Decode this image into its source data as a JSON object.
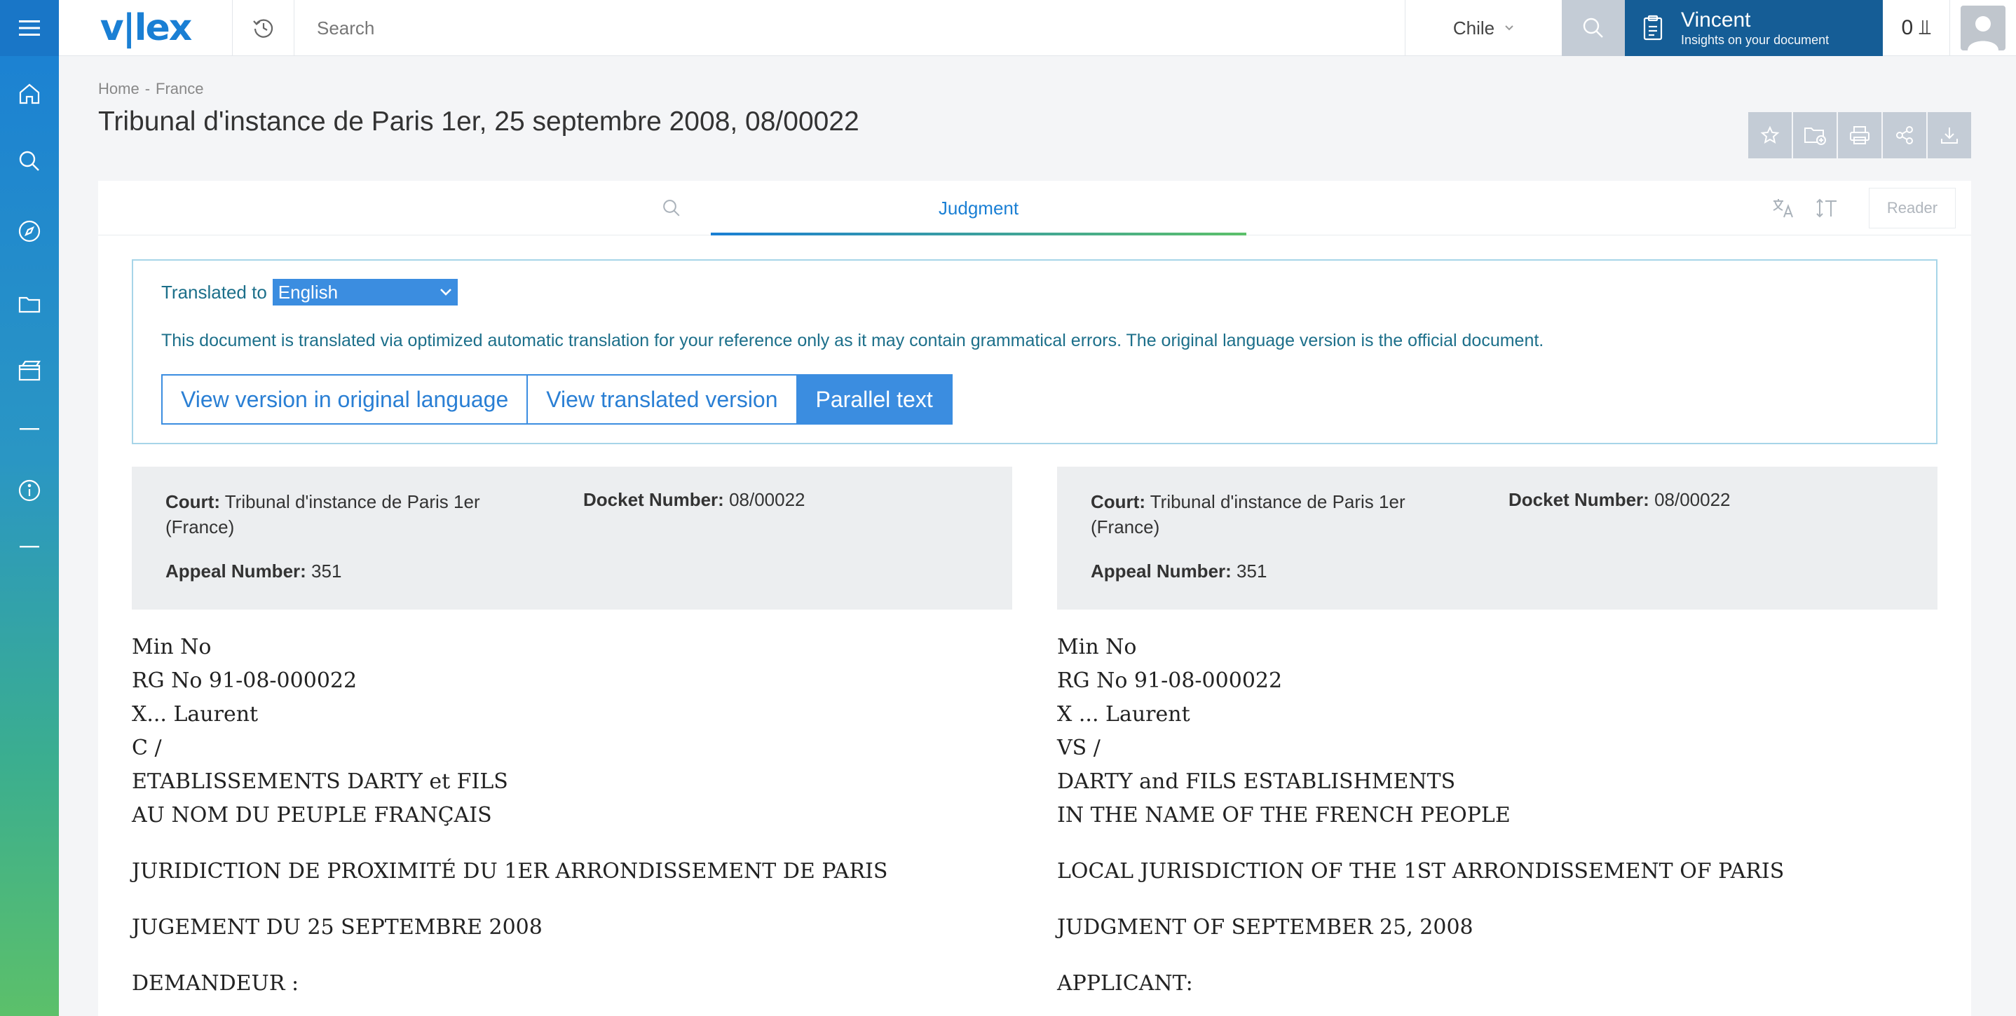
{
  "header": {
    "logo": "v|lex",
    "search_placeholder": "Search",
    "country": "Chile",
    "insights": {
      "title": "Vincent",
      "subtitle": "Insights on your document"
    },
    "credits": "0 ⫫"
  },
  "sidebar": {
    "items": [
      "menu-icon",
      "home-icon",
      "search-icon",
      "compass-icon",
      "folder-icon",
      "video-icon",
      "dash-icon",
      "info-icon",
      "dash-icon"
    ]
  },
  "breadcrumb": [
    "Home",
    "-",
    "France"
  ],
  "page_title": "Tribunal d'instance de Paris 1er, 25 septembre 2008, 08/00022",
  "document": {
    "tab_label": "Judgment",
    "reader_label": "Reader",
    "translation": {
      "label": "Translated to",
      "language": "English",
      "note": "This document is translated via optimized automatic translation for your reference only as it may contain grammatical errors. The original language version is the official document.",
      "buttons": [
        "View version in original language",
        "View translated version",
        "Parallel text"
      ],
      "active_button": "Parallel text"
    },
    "meta": {
      "court_label": "Court:",
      "court_value": "Tribunal d'instance de Paris 1er (France)",
      "docket_label": "Docket Number:",
      "docket_value": "08/00022",
      "appeal_label": "Appeal Number:",
      "appeal_value": "351"
    },
    "original": {
      "lines": [
        "Min No",
        "RG No 91-08-000022",
        "X... Laurent",
        "C /",
        "ETABLISSEMENTS DARTY et FILS",
        "AU NOM DU PEUPLE FRANÇAIS"
      ],
      "paragraphs": [
        "JURIDICTION DE PROXIMITÉ DU 1ER ARRONDISSEMENT DE PARIS",
        "JUGEMENT DU 25 SEPTEMBRE 2008",
        "DEMANDEUR :"
      ]
    },
    "translated": {
      "lines": [
        "Min No",
        "RG No 91-08-000022",
        "X ... Laurent",
        "VS /",
        "DARTY and FILS ESTABLISHMENTS",
        "IN THE NAME OF THE FRENCH PEOPLE"
      ],
      "paragraphs": [
        "LOCAL JURISDICTION OF THE 1ST ARRONDISSEMENT OF PARIS",
        "JUDGMENT OF SEPTEMBER 25, 2008",
        "APPLICANT:"
      ]
    }
  },
  "colors": {
    "accent": "#1a7fd4",
    "insights_bg": "#155d96",
    "button_blue": "#3b8de0",
    "tool_gray": "#c4ccd6",
    "note_teal": "#1c6f8a"
  }
}
